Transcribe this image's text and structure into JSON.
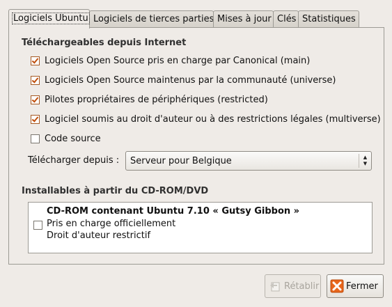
{
  "tabs": [
    {
      "label": "Logiciels Ubuntu",
      "active": true
    },
    {
      "label": "Logiciels de tierces parties",
      "active": false
    },
    {
      "label": "Mises à jour",
      "active": false
    },
    {
      "label": "Clés",
      "active": false
    },
    {
      "label": "Statistiques",
      "active": false
    }
  ],
  "internet": {
    "heading": "Téléchargeables depuis Internet",
    "options": [
      {
        "label": "Logiciels Open Source pris en charge par Canonical (main)",
        "checked": true
      },
      {
        "label": "Logiciels Open Source maintenus par la communauté (universe)",
        "checked": true
      },
      {
        "label": "Pilotes propriétaires de périphériques (restricted)",
        "checked": true
      },
      {
        "label": "Logiciel soumis au droit d'auteur ou à des restrictions légales (multiverse)",
        "checked": true
      },
      {
        "label": "Code source",
        "checked": false
      }
    ],
    "download_from_label": "Télécharger depuis :",
    "download_from_value": "Serveur pour Belgique"
  },
  "cdrom": {
    "heading": "Installables à partir du CD-ROM/DVD",
    "title": "CD-ROM contenant Ubuntu 7.10 « Gutsy Gibbon »",
    "line1": "Pris en charge officiellement",
    "line2": "Droit d'auteur restrictif",
    "checked": false
  },
  "buttons": {
    "revert": "Rétablir",
    "close": "Fermer"
  },
  "colors": {
    "check_accent": "#c04f0c",
    "close_icon": "#e8661c"
  },
  "icons": {
    "revert": "revert-icon",
    "close": "close-icon"
  }
}
